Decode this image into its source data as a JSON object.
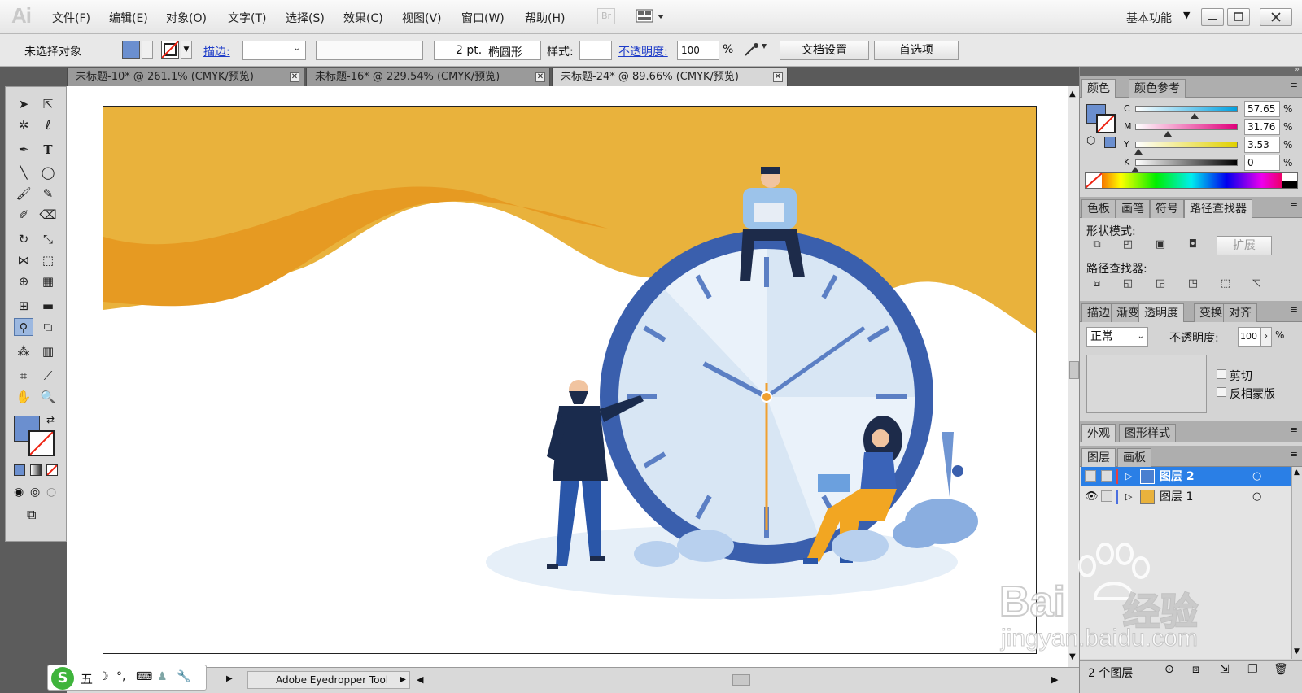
{
  "app": {
    "logo": "Ai",
    "menus": [
      "文件(F)",
      "编辑(E)",
      "对象(O)",
      "文字(T)",
      "选择(S)",
      "效果(C)",
      "视图(V)",
      "窗口(W)",
      "帮助(H)"
    ],
    "br_label": "Br",
    "workspace": "基本功能"
  },
  "control": {
    "selection_status": "未选择对象",
    "stroke_label": "描边:",
    "brush_size": "2 pt.",
    "brush_shape": "椭圆形",
    "style_label": "样式:",
    "opacity_label": "不透明度:",
    "opacity_value": "100",
    "percent": "%",
    "doc_settings": "文档设置",
    "preferences": "首选项"
  },
  "tabs": [
    {
      "label": "未标题-10* @ 261.1% (CMYK/预览)",
      "active": false
    },
    {
      "label": "未标题-16* @ 229.54% (CMYK/预览)",
      "active": false
    },
    {
      "label": "未标题-24* @ 89.66% (CMYK/预览)",
      "active": true
    }
  ],
  "status": {
    "tool_name": "Adobe Eyedropper Tool"
  },
  "color_panel": {
    "tab_color": "颜色",
    "tab_color_guide": "颜色参考",
    "fill_color": "#6b8fcf",
    "channels": [
      {
        "name": "C",
        "value": "57.65",
        "percent": 57.65
      },
      {
        "name": "M",
        "value": "31.76",
        "percent": 31.76
      },
      {
        "name": "Y",
        "value": "3.53",
        "percent": 3.53
      },
      {
        "name": "K",
        "value": "0",
        "percent": 0
      }
    ],
    "pct": "%"
  },
  "pathfinder_panel": {
    "tabs": [
      "色板",
      "画笔",
      "符号",
      "路径查找器"
    ],
    "shape_modes": "形状模式:",
    "expand": "扩展",
    "pathfinders": "路径查找器:"
  },
  "transparency_panel": {
    "tabs": [
      "描边",
      "渐变",
      "透明度",
      "变换",
      "对齐"
    ],
    "mode": "正常",
    "opacity_label": "不透明度:",
    "opacity_value": "100",
    "pct": "%",
    "clip": "剪切",
    "invert_mask": "反相蒙版"
  },
  "appearance_panel": {
    "tabs": [
      "外观",
      "图形样式"
    ]
  },
  "layers_panel": {
    "tabs": [
      "图层",
      "画板"
    ],
    "layers": [
      {
        "name": "图层 2",
        "selected": true,
        "visible": false,
        "color": "#e84040"
      },
      {
        "name": "图层 1",
        "selected": false,
        "visible": true,
        "color": "#4a6fe0"
      }
    ],
    "count": "2 个图层"
  },
  "ime": {
    "mode": "五"
  },
  "watermark": {
    "brand_latin": "Bai",
    "brand_cn": "经验",
    "url": "jingyan.baidu.com"
  },
  "colors": {
    "accent_orange": "#e9b23c",
    "clock_blue": "#3a5fad",
    "clock_face": "#d8e6f4"
  }
}
